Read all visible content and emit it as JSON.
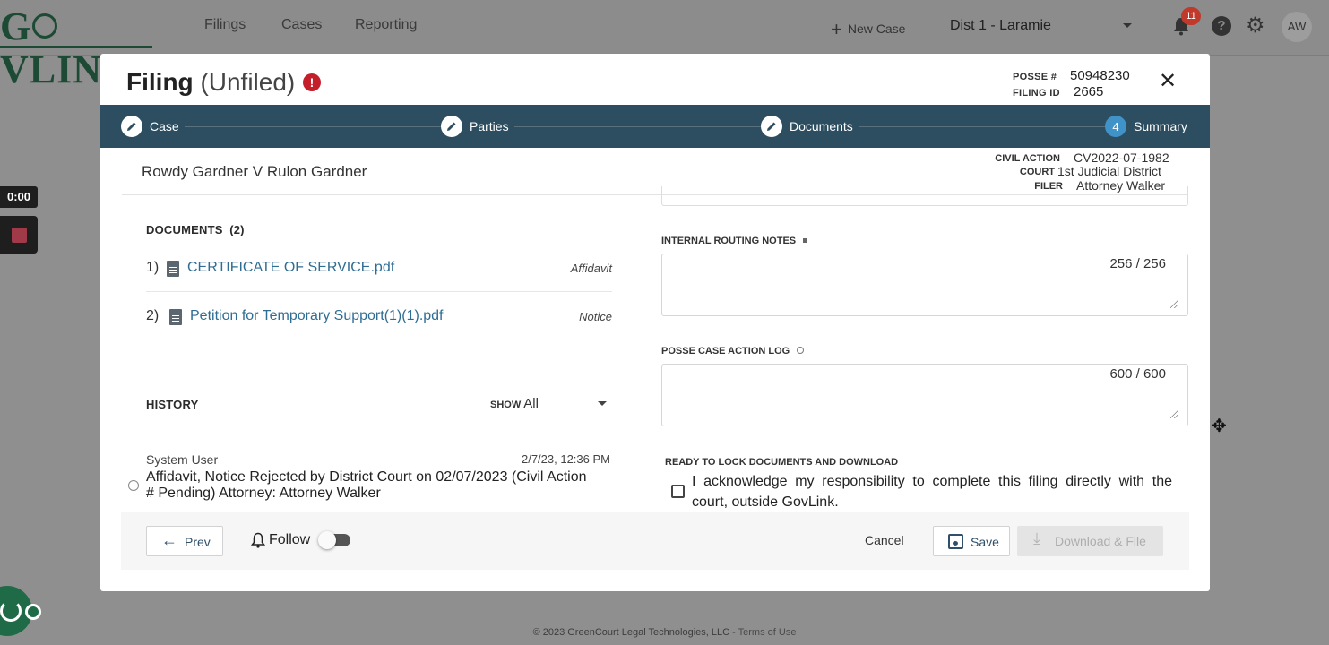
{
  "header": {
    "logo_text": "GOVLINK",
    "nav": [
      "Filings",
      "Cases",
      "Reporting"
    ],
    "new_case_label": "New Case",
    "district": "Dist 1 - Laramie",
    "notification_count": "11",
    "help_glyph": "?",
    "avatar_initials": "AW"
  },
  "overlay": {
    "timer": "0:00"
  },
  "modal": {
    "title": "Filing",
    "status": "(Unfiled)",
    "alert_glyph": "!",
    "posse_label": "POSSE #",
    "posse_value": "50948230",
    "filing_id_label": "FILING ID",
    "filing_id_value": "2665",
    "steps": [
      {
        "label": "Case",
        "icon": "pencil-icon"
      },
      {
        "label": "Parties",
        "icon": "pencil-icon"
      },
      {
        "label": "Documents",
        "icon": "pencil-icon"
      },
      {
        "label": "Summary",
        "number": "4"
      }
    ],
    "case_title": "Rowdy Gardner V Rulon Gardner",
    "case_info": {
      "civil_action_label": "CIVIL ACTION",
      "civil_action_value": "CV2022-07-1982",
      "court_label": "COURT",
      "court_value": "1st Judicial District",
      "filer_label": "FILER",
      "filer_value": "Attorney Walker"
    },
    "documents": {
      "heading": "DOCUMENTS",
      "count": "(2)",
      "items": [
        {
          "num": "1)",
          "name": "CERTIFICATE OF SERVICE.pdf",
          "type": "Affidavit"
        },
        {
          "num": "2)",
          "name": "Petition for Temporary Support(1)(1).pdf",
          "type": "Notice"
        }
      ]
    },
    "history": {
      "heading": "HISTORY",
      "show_label": "SHOW",
      "show_value": "All",
      "entry_user": "System User",
      "entry_time": "2/7/23, 12:36 PM",
      "entry_text": "Affidavit, Notice Rejected by District Court on 02/07/2023 (Civil Action # Pending) Attorney: Attorney Walker"
    },
    "routing_notes": {
      "label": "INTERNAL ROUTING NOTES",
      "counter": "256 / 256"
    },
    "posse_log": {
      "label": "POSSE CASE ACTION LOG",
      "counter": "600 / 600"
    },
    "ready_label": "READY TO LOCK DOCUMENTS AND DOWNLOAD",
    "acknowledge_text": "I acknowledge my responsibility to complete this filing directly with the court, outside GovLink.",
    "actions": {
      "prev": "Prev",
      "follow": "Follow",
      "cancel": "Cancel",
      "save": "Save",
      "download": "Download & File"
    }
  },
  "footer": {
    "copyright": "© 2023 GreenCourt Legal Technologies, LLC - ",
    "terms": "Terms of Use"
  }
}
